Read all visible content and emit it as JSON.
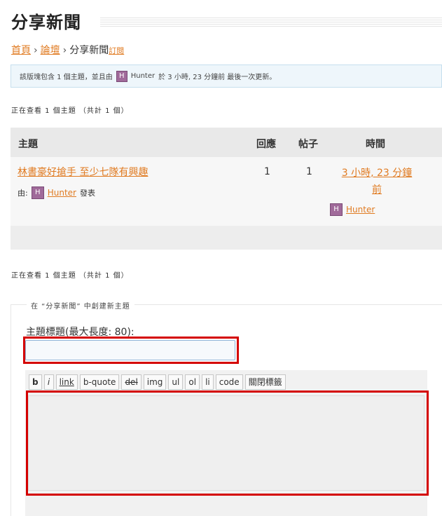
{
  "page": {
    "title": "分享新聞"
  },
  "breadcrumb": {
    "home": "首頁",
    "sep1": "›",
    "forum": "論壇",
    "sep2": "›",
    "current": "分享新聞",
    "subscribe": "訂閱"
  },
  "info": {
    "before": "該版塊包含 1 個主題，並且由",
    "avatar": "H",
    "user": "Hunter",
    "after": "於 3 小時, 23 分鐘前 最後一次更新。"
  },
  "viewing": {
    "top": "正在查看 1 個主題 （共計 1 個）",
    "bottom": "正在查看 1 個主題 （共計 1 個）"
  },
  "table": {
    "headers": {
      "topic": "主題",
      "replies": "回應",
      "posts": "帖子",
      "time": "時間"
    },
    "rows": [
      {
        "title": "林書豪好搶手 至少七隊有興趣",
        "by_label": "由:",
        "avatar": "H",
        "author": "Hunter",
        "posted_label": "發表",
        "replies": "1",
        "posts": "1",
        "time_line1": "3 小時, 23 分鐘",
        "time_line2": "前",
        "last_avatar": "H",
        "last_user": "Hunter"
      }
    ]
  },
  "new_topic": {
    "legend": "在 “分享新聞” 中創建新主題",
    "title_label": "主題標題(最大長度: 80):",
    "title_value": ""
  },
  "toolbar": {
    "buttons": [
      "b",
      "i",
      "link",
      "b-quote",
      "del",
      "img",
      "ul",
      "ol",
      "li",
      "code",
      "關閉標籤"
    ]
  },
  "colors": {
    "link": "#e07b22",
    "highlight": "#d40000",
    "info_bg": "#eef6fb"
  }
}
